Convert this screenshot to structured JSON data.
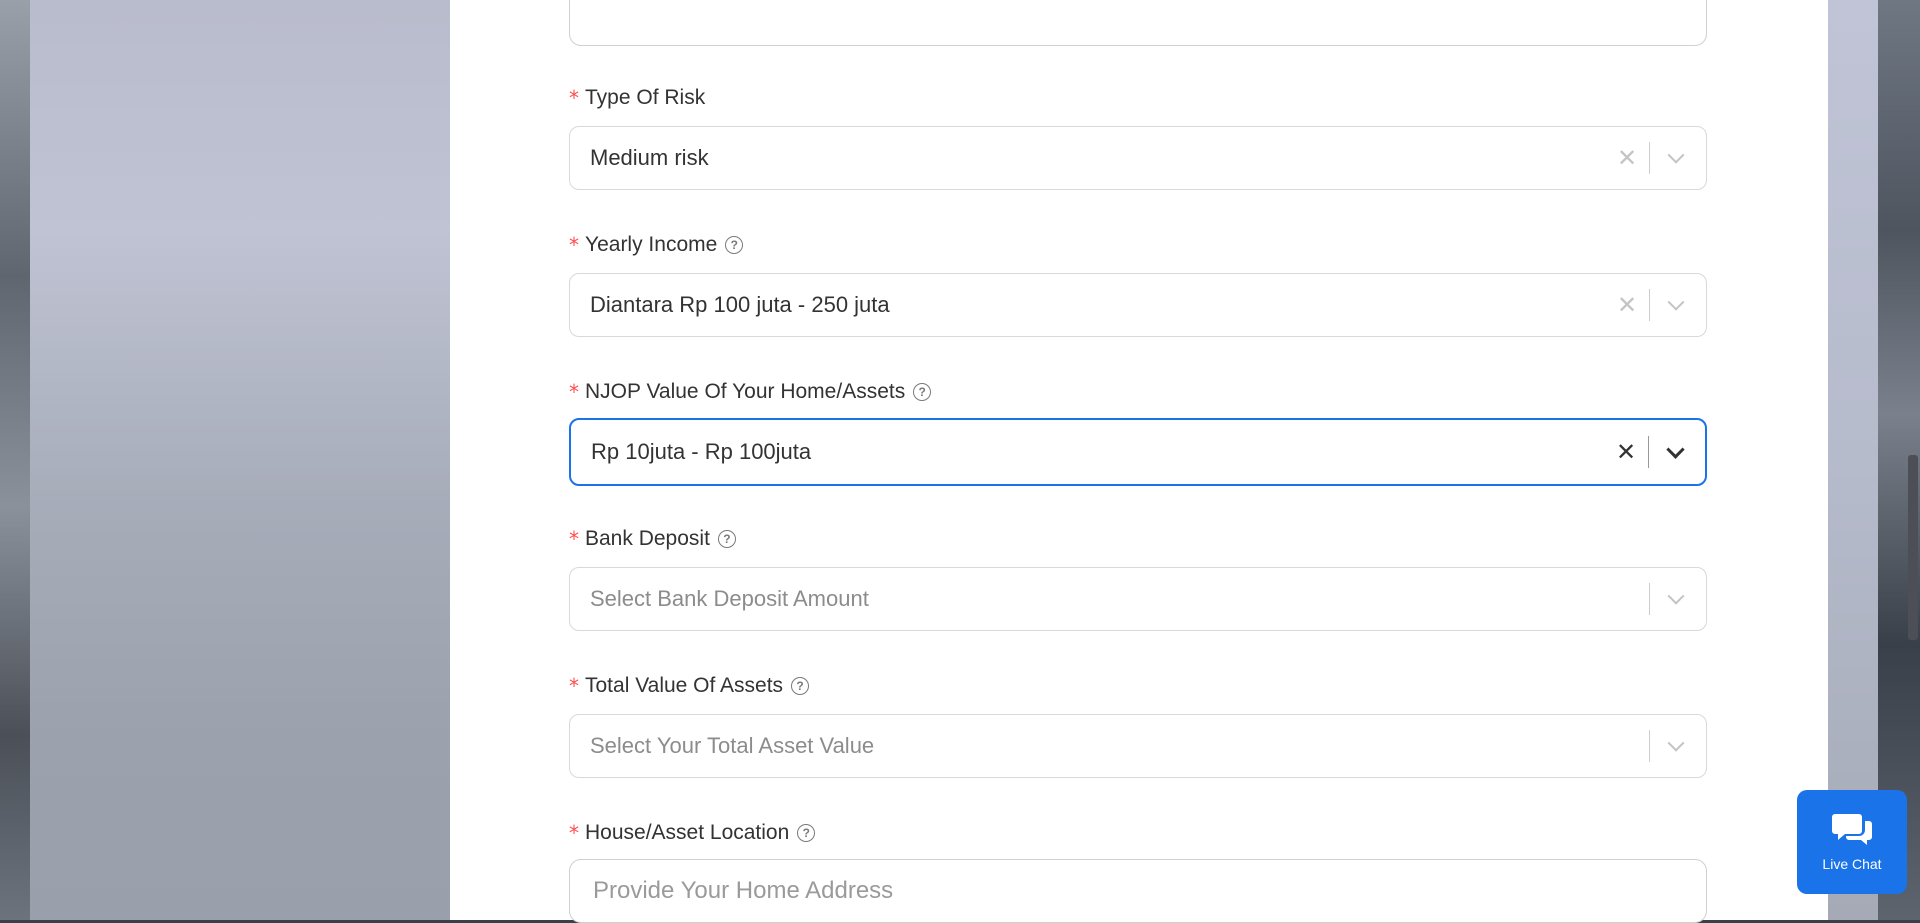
{
  "colors": {
    "accent": "#1a73e8",
    "required": "#ff4d4f",
    "text": "#333333",
    "placeholder": "#8c8c8c"
  },
  "form": {
    "fields": [
      {
        "label": "Type Of Risk",
        "required": true,
        "help": false,
        "value": "Medium risk",
        "placeholder": "",
        "clearable": true,
        "focused": false
      },
      {
        "label": "Yearly Income",
        "required": true,
        "help": true,
        "value": "Diantara Rp 100 juta - 250 juta",
        "placeholder": "",
        "clearable": true,
        "focused": false
      },
      {
        "label": "NJOP Value Of Your Home/Assets",
        "required": true,
        "help": true,
        "value": "Rp 10juta - Rp 100juta",
        "placeholder": "",
        "clearable": true,
        "focused": true
      },
      {
        "label": "Bank Deposit",
        "required": true,
        "help": true,
        "value": "",
        "placeholder": "Select Bank Deposit Amount",
        "clearable": false,
        "focused": false
      },
      {
        "label": "Total Value Of Assets",
        "required": true,
        "help": true,
        "value": "",
        "placeholder": "Select Your Total Asset Value",
        "clearable": false,
        "focused": false
      },
      {
        "label": "House/Asset Location",
        "required": true,
        "help": true,
        "value": "",
        "placeholder": "Provide Your Home Address"
      }
    ],
    "required_mark": "*",
    "help_glyph": "?",
    "clear_glyph": "✕"
  },
  "livechat": {
    "label": "Live Chat",
    "icon": "chat-bubbles-icon"
  }
}
